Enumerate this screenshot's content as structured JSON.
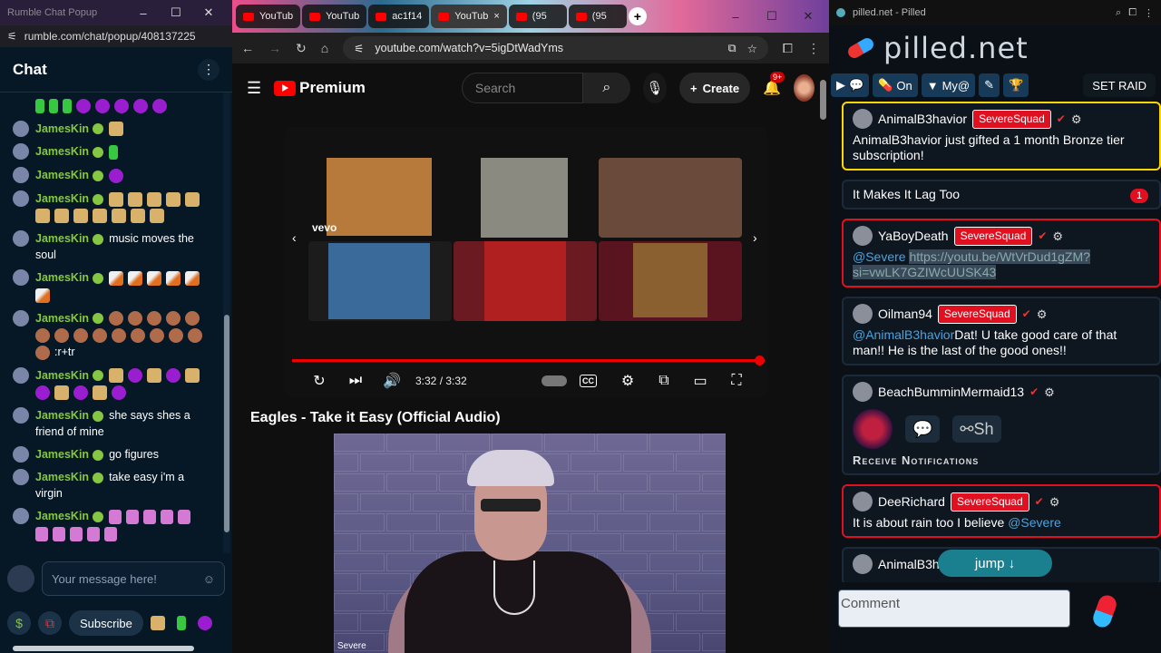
{
  "rumble": {
    "title": "Rumble Chat Popup",
    "url": "rumble.com/chat/popup/408137225",
    "header": "Chat",
    "messages": [
      {
        "user": "",
        "text": "",
        "emotes": [
          "green",
          "green",
          "green",
          "purple",
          "purple",
          "purple",
          "purple",
          "purple"
        ]
      },
      {
        "user": "JamesKin",
        "text": "",
        "emotes": [
          "dog"
        ]
      },
      {
        "user": "JamesKin",
        "text": "",
        "emotes": [
          "green"
        ]
      },
      {
        "user": "JamesKin",
        "text": "",
        "emotes": [
          "purple"
        ]
      },
      {
        "user": "JamesKin",
        "text": "",
        "emotes": [
          "dog",
          "dog",
          "dog",
          "dog",
          "dog",
          "dog",
          "dog",
          "dog",
          "dog",
          "dog",
          "dog",
          "dog"
        ]
      },
      {
        "user": "JamesKin",
        "text": "music moves the soul",
        "emotes": []
      },
      {
        "user": "JamesKin",
        "text": "",
        "emotes": [
          "rocket",
          "rocket",
          "rocket",
          "rocket",
          "rocket",
          "rocket"
        ]
      },
      {
        "user": "JamesKin",
        "text": ":r+tr",
        "emotes": [
          "man",
          "man",
          "man",
          "man",
          "man",
          "man",
          "man",
          "man",
          "man",
          "man",
          "man",
          "man",
          "man",
          "man",
          "man"
        ]
      },
      {
        "user": "JamesKin",
        "text": "",
        "emotes": [
          "dog",
          "purple",
          "dog",
          "purple",
          "dog",
          "purple",
          "dog",
          "purple",
          "dog",
          "purple"
        ]
      },
      {
        "user": "JamesKin",
        "text": "she says shes a friend of mine",
        "emotes": []
      },
      {
        "user": "JamesKin",
        "text": "go figures",
        "emotes": []
      },
      {
        "user": "JamesKin",
        "text": "take easy i'm a virgin",
        "emotes": []
      },
      {
        "user": "JamesKin",
        "text": "",
        "emotes": [
          "pink",
          "pink",
          "pink",
          "pink",
          "pink",
          "pink",
          "pink",
          "pink",
          "pink",
          "pink"
        ]
      }
    ],
    "input_placeholder": "Your message here!",
    "subscribe_label": "Subscribe"
  },
  "chrome": {
    "tabs": [
      {
        "label": "YouTub",
        "active": false
      },
      {
        "label": "YouTub",
        "active": false
      },
      {
        "label": "ac1f14",
        "active": false
      },
      {
        "label": "YouTub",
        "active": true
      },
      {
        "label": "(95",
        "active": false
      },
      {
        "label": "(95",
        "active": false
      }
    ],
    "url": "youtube.com/watch?v=5igDtWadYms",
    "yt": {
      "brand": "Premium",
      "search_placeholder": "Search",
      "create_label": "Create",
      "notif_count": "9+",
      "time": "3:32 / 3:32",
      "progress": 1.0,
      "vevo": "vevo",
      "video_title": "Eagles - Take it Easy (Official Audio)",
      "cam_label": "Severe"
    },
    "thumbs": [
      {
        "color": "#b87a3a"
      },
      {
        "color": "#8a8a80"
      },
      {
        "color": "#6a4a3a"
      },
      {
        "color": "#3a6a9a"
      },
      {
        "color": "#b02020"
      },
      {
        "color": "#8a6030"
      }
    ]
  },
  "pilled": {
    "title": "pilled.net - Pilled",
    "logo": "pilled.net",
    "toolbar": {
      "on_label": "On",
      "my_label": "My@",
      "raid_label": "SET RAID"
    },
    "cards": [
      {
        "style": "gold",
        "user": "AnimalB3havior",
        "squad": "SevereSquad",
        "text": "AnimalB3havior just gifted a 1 month Bronze tier subscription!",
        "mention": ""
      },
      {
        "style": "plain",
        "user": "",
        "squad": "",
        "text": "It Makes It Lag Too",
        "mention": "",
        "unread": "1"
      },
      {
        "style": "red",
        "user": "YaBoyDeath",
        "squad": "SevereSquad",
        "text": "",
        "mention": "@Severe",
        "link": "https://youtu.be/WtVrDud1gZM?si=vwLK7GZIWcUUSK43"
      },
      {
        "style": "plain",
        "user": "Oilman94",
        "squad": "SevereSquad",
        "text": "Dat! U take good care of that man!! He is the last of the good ones!!",
        "mention": "@AnimalB3havior"
      },
      {
        "style": "plain",
        "user": "BeachBumminMermaid13",
        "squad": "",
        "text": "",
        "mention": "",
        "share": "Sh",
        "receive": "Receive Notifications"
      },
      {
        "style": "red",
        "user": "DeeRichard",
        "squad": "SevereSquad",
        "text": "It is about rain too I believe ",
        "mention": "@Severe"
      },
      {
        "style": "plain",
        "user": "AnimalB3havior",
        "squad": "",
        "text": "",
        "mention": ""
      }
    ],
    "jump_label": "jump ↓",
    "comment_placeholder": "Comment"
  }
}
